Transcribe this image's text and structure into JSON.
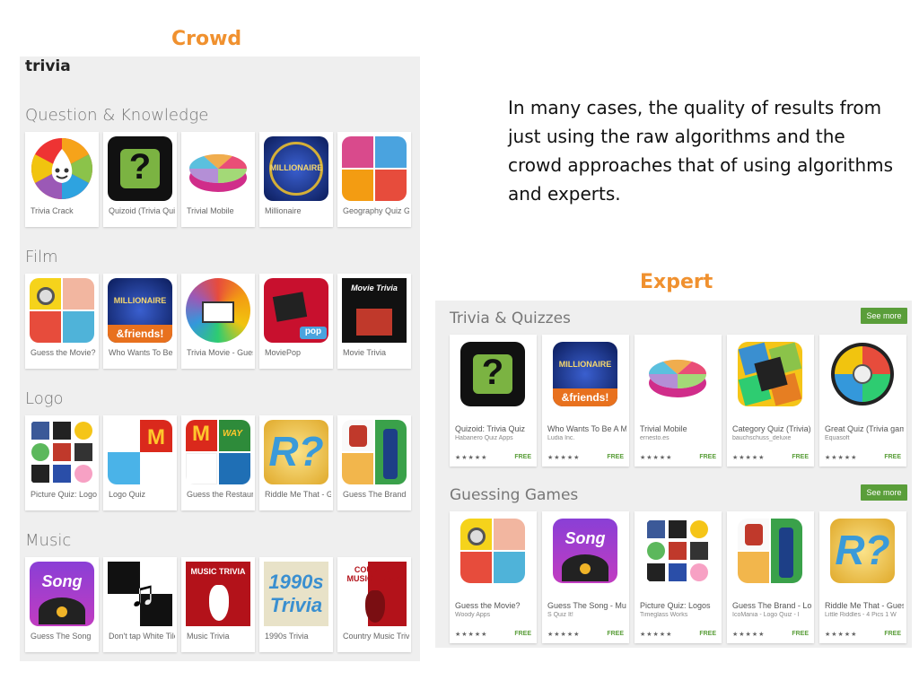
{
  "headings": {
    "crowd": "Crowd",
    "expert": "Expert"
  },
  "quote": "In many cases, the quality of results from just using the raw algorithms and the crowd approaches that of using algorithms and experts.",
  "crowd": {
    "query": "trivia",
    "sections": [
      {
        "title": "Question & Knowledge",
        "apps": [
          "Trivia Crack",
          "Quizoid (Trivia Quiz)",
          "Trivial Mobile",
          "Millionaire",
          "Geography Quiz Game"
        ]
      },
      {
        "title": "Film",
        "apps": [
          "Guess the Movie?",
          "Who Wants To Be a Millionaire",
          "Trivia Movie - Guess",
          "MoviePop",
          "Movie Trivia"
        ]
      },
      {
        "title": "Logo",
        "apps": [
          "Picture Quiz: Logos",
          "Logo Quiz",
          "Guess the Restaurant",
          "Riddle Me That - Guess",
          "Guess The Brand"
        ]
      },
      {
        "title": "Music",
        "apps": [
          "Guess The Song",
          "Don't tap White Tile",
          "Music Trivia",
          "1990s Trivia",
          "Country Music Trivia"
        ]
      }
    ]
  },
  "expert": {
    "see_more": "See more",
    "sections": [
      {
        "title": "Trivia & Quizzes",
        "apps": [
          {
            "title": "Quizoid: Trivia Quiz",
            "dev": "Habanero Quiz Apps",
            "stars": "★★★★★",
            "price": "FREE"
          },
          {
            "title": "Who Wants To Be A Millionaire",
            "dev": "Ludia Inc.",
            "stars": "★★★★★",
            "price": "FREE"
          },
          {
            "title": "Trivial Mobile",
            "dev": "ernesto.es",
            "stars": "★★★★★",
            "price": "FREE"
          },
          {
            "title": "Category Quiz (Trivia)",
            "dev": "bauchschuss_deluxe",
            "stars": "★★★★★",
            "price": "FREE"
          },
          {
            "title": "Great Quiz (Trivia game)",
            "dev": "Equasoft",
            "stars": "★★★★★",
            "price": "FREE"
          }
        ]
      },
      {
        "title": "Guessing Games",
        "apps": [
          {
            "title": "Guess the Movie?",
            "dev": "Woody Apps",
            "stars": "★★★★★",
            "price": "FREE"
          },
          {
            "title": "Guess The Song - Music",
            "dev": "S Quiz It!",
            "stars": "★★★★★",
            "price": "FREE"
          },
          {
            "title": "Picture Quiz: Logos",
            "dev": "Timeglass Works",
            "stars": "★★★★★",
            "price": "FREE"
          },
          {
            "title": "Guess The Brand - Logo",
            "dev": "IcoMania - Logo Quiz - I",
            "stars": "★★★★★",
            "price": "FREE"
          },
          {
            "title": "Riddle Me That - Guess",
            "dev": "Little Riddles - 4 Pics 1 W",
            "stars": "★★★★★",
            "price": "FREE"
          }
        ]
      }
    ]
  },
  "icon_text": {
    "millionaire": "MILLIONAIRE",
    "friends": "&friends!",
    "movie_trivia": "Movie Trivia",
    "pop": "pop",
    "way": "WAY",
    "riddle": "R?",
    "song": "Song",
    "music_trivia": "MUSIC TRIVIA",
    "nineties": "1990s",
    "trivia_word": "Trivia",
    "country_trivia": "COUNTRY MUSIC TRIVIA",
    "quizoid": "?"
  }
}
